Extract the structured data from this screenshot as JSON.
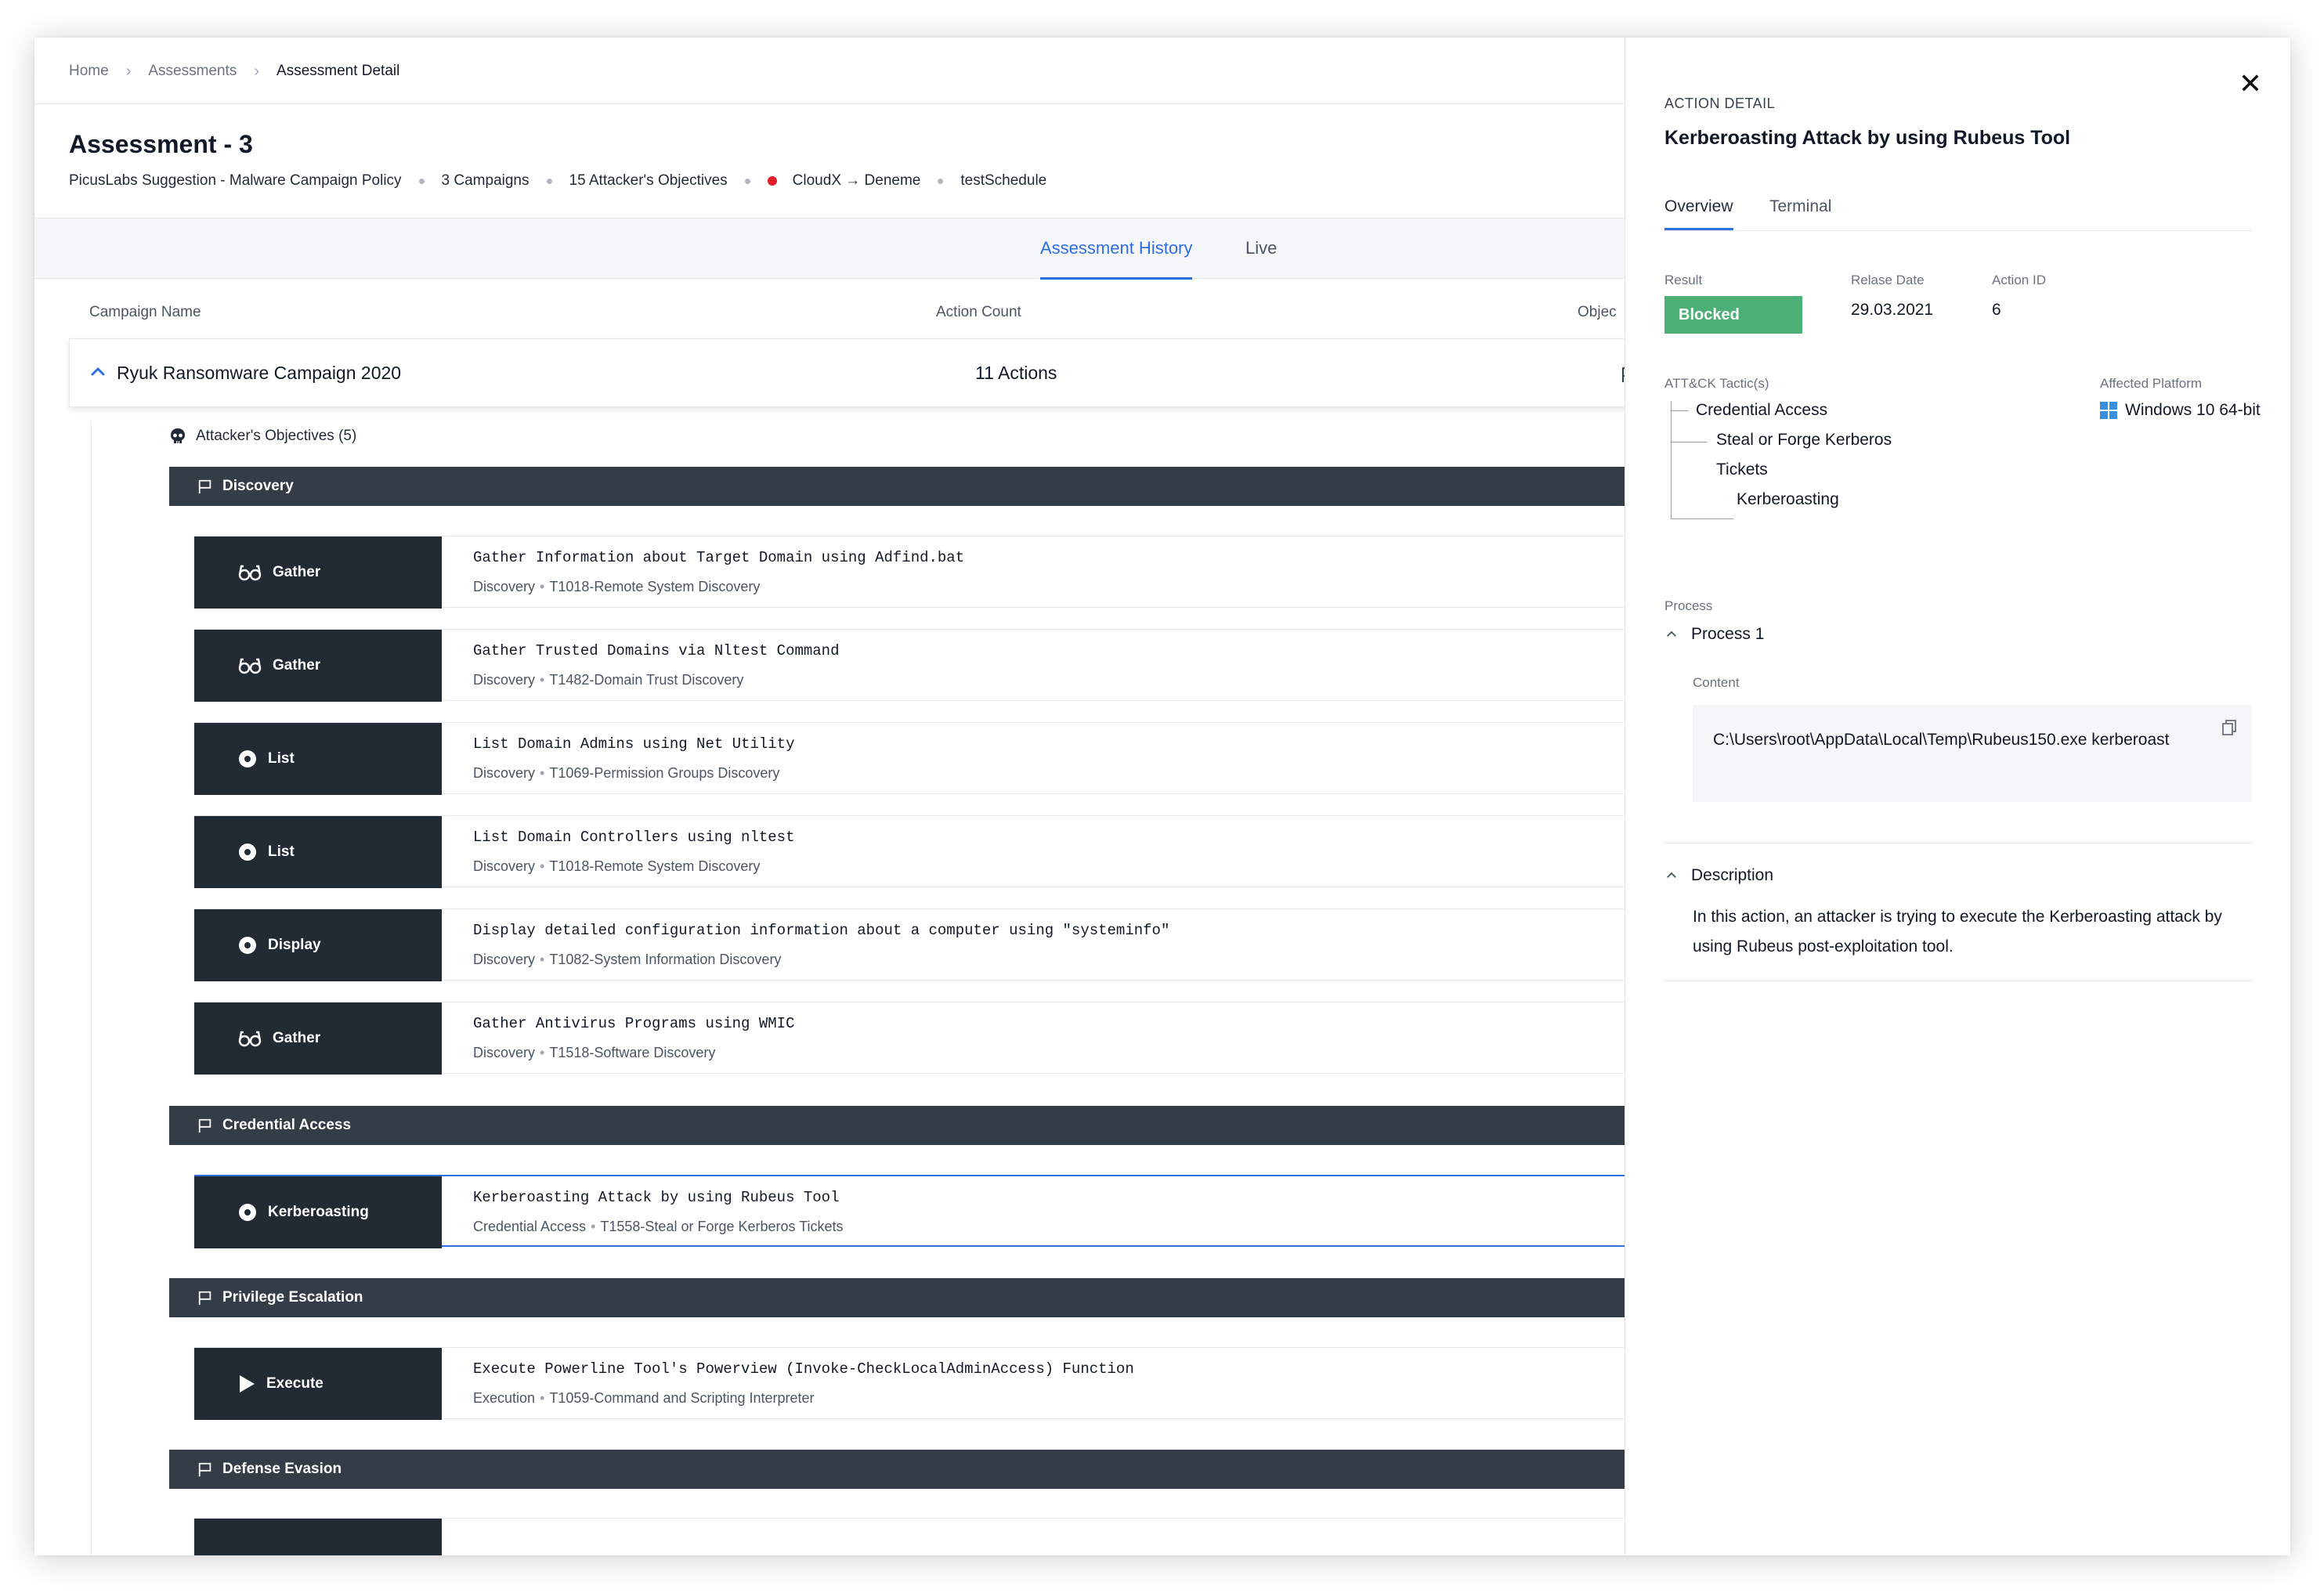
{
  "breadcrumb": {
    "home": "Home",
    "assessments": "Assessments",
    "current": "Assessment Detail"
  },
  "assessment": {
    "title": "Assessment - 3",
    "policy": "PicusLabs Suggestion - Malware Campaign Policy",
    "campaigns": "3 Campaigns",
    "objectives": "15 Attacker's Objectives",
    "agent": "CloudX → Deneme",
    "schedule": "testSchedule"
  },
  "tabs": {
    "history": "Assessment History",
    "live": "Live"
  },
  "table": {
    "col_campaign": "Campaign Name",
    "col_action_count": "Action Count",
    "col_objective": "Objec"
  },
  "campaign": {
    "name": "Ryuk Ransomware Campaign 2020",
    "count": "11 Actions"
  },
  "objectives_label": "Attacker's Objectives (5)",
  "sections": {
    "discovery": "Discovery",
    "credential": "Credential Access",
    "privilege": "Privilege Escalation",
    "defense": "Defense Evasion"
  },
  "actions": [
    {
      "verb": "Gather",
      "icon": "glasses-icon",
      "title": "Gather Information about Target Domain using Adfind.bat",
      "tactic": "Discovery",
      "technique": "T1018-Remote System Discovery"
    },
    {
      "verb": "Gather",
      "icon": "glasses-icon",
      "title": "Gather Trusted Domains via Nltest Command",
      "tactic": "Discovery",
      "technique": "T1482-Domain Trust Discovery"
    },
    {
      "verb": "List",
      "icon": "dot-circle-icon",
      "title": "List Domain Admins using Net Utility",
      "tactic": "Discovery",
      "technique": "T1069-Permission Groups Discovery"
    },
    {
      "verb": "List",
      "icon": "dot-circle-icon",
      "title": "List Domain Controllers using nltest",
      "tactic": "Discovery",
      "technique": "T1018-Remote System Discovery"
    },
    {
      "verb": "Display",
      "icon": "dot-circle-icon",
      "title": "Display detailed configuration information about a computer using \"systeminfo\"",
      "tactic": "Discovery",
      "technique": "T1082-System Information Discovery"
    },
    {
      "verb": "Gather",
      "icon": "glasses-icon",
      "title": "Gather Antivirus Programs using WMIC",
      "tactic": "Discovery",
      "technique": "T1518-Software Discovery"
    },
    {
      "verb": "Kerberoasting",
      "icon": "dot-circle-icon",
      "title": "Kerberoasting Attack by using Rubeus Tool",
      "tactic": "Credential Access",
      "technique": "T1558-Steal or Forge Kerberos Tickets"
    },
    {
      "verb": "Execute",
      "icon": "play-icon",
      "title": "Execute Powerline Tool's Powerview (Invoke-CheckLocalAdminAccess) Function",
      "tactic": "Execution",
      "technique": "T1059-Command and Scripting Interpreter"
    }
  ],
  "panel": {
    "eyebrow": "ACTION DETAIL",
    "title": "Kerberoasting Attack by using Rubeus Tool",
    "tab_overview": "Overview",
    "tab_terminal": "Terminal",
    "result_label": "Result",
    "result_value": "Blocked",
    "release_label": "Relase Date",
    "release_value": "29.03.2021",
    "action_id_label": "Action ID",
    "action_id_value": "6",
    "tactic_label": "ATT&CK Tactic(s)",
    "tactic_1": "Credential Access",
    "tactic_2a": "Steal or Forge Kerberos",
    "tactic_2b": "Tickets",
    "tactic_3": "Kerberoasting",
    "platform_label": "Affected Platform",
    "platform_value": "Windows 10 64-bit",
    "process_label": "Process",
    "process_name": "Process 1",
    "content_label": "Content",
    "content_value": "C:\\Users\\root\\AppData\\Local\\Temp\\Rubeus150.exe kerberoast",
    "description_label": "Description",
    "description_value": "In this action, an attacker is trying to execute the Kerberoasting attack by using Rubeus post-exploitation tool."
  },
  "colors": {
    "accent": "#2f6fe0",
    "blocked": "#4caf76",
    "section_bg": "#333c47",
    "badge_bg": "#222a33",
    "alert": "#e11d2a"
  }
}
